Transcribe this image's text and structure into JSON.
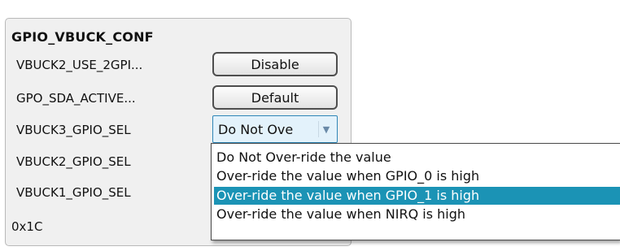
{
  "panel": {
    "title": "GPIO_VBUCK_CONF",
    "rows": [
      {
        "label": "VBUCK2_USE_2GPI...",
        "control": "Disable"
      },
      {
        "label": "GPO_SDA_ACTIVE...",
        "control": "Default"
      },
      {
        "label": "VBUCK3_GPIO_SEL",
        "control": "Do Not Ove"
      },
      {
        "label": "VBUCK2_GPIO_SEL"
      },
      {
        "label": "VBUCK1_GPIO_SEL"
      }
    ],
    "address": "0x1C"
  },
  "dropdown": {
    "options": [
      "Do Not Over-ride the value",
      "Over-ride the value when GPIO_0 is high",
      "Over-ride the value when GPIO_1 is high",
      "Over-ride the value when NIRQ is high"
    ],
    "highlighted_option": "Over-ride the value when GPIO_1 is high",
    "arrow_icon": "chevron-down-icon"
  },
  "colors": {
    "panel_bg": "#f0f0f0",
    "highlight": "#1b93b5",
    "combo_bg": "#e3f2fb"
  }
}
